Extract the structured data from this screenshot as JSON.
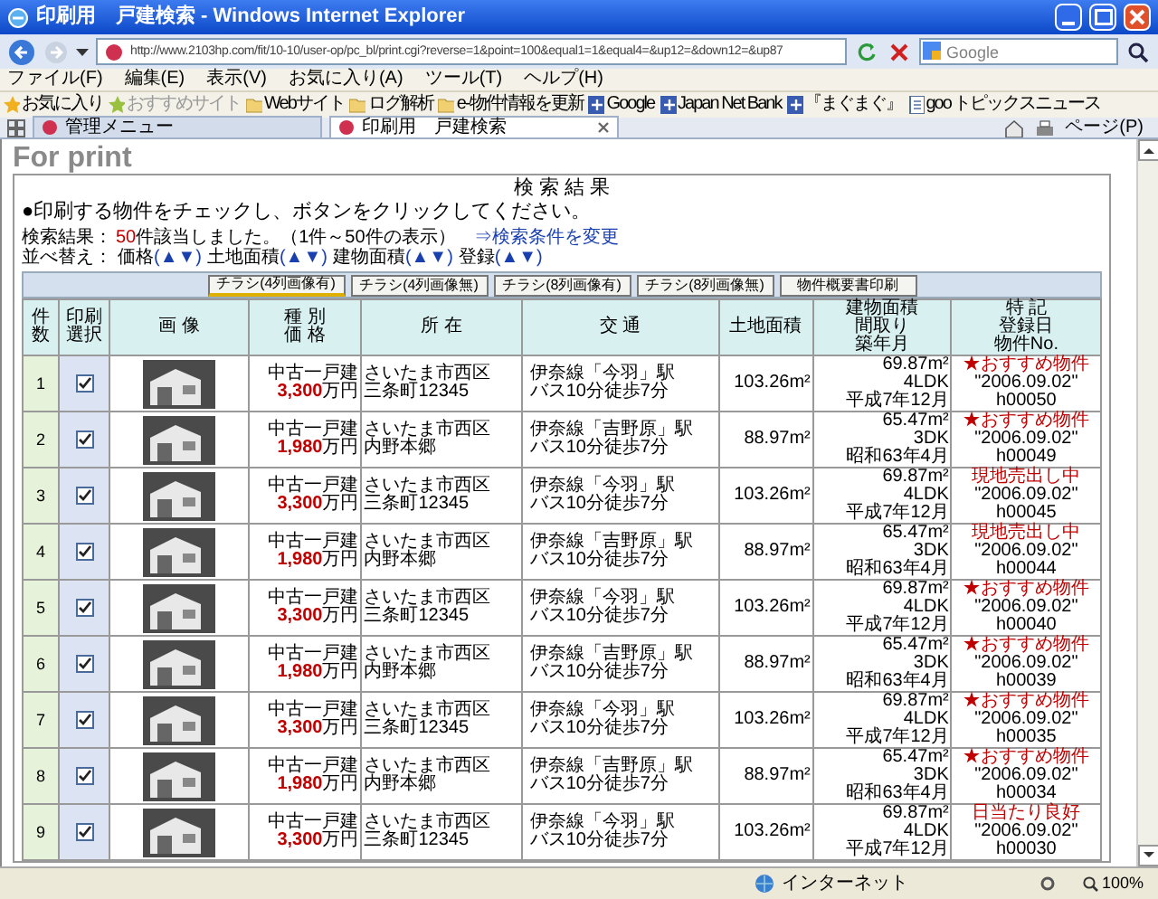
{
  "window": {
    "title": "印刷用　戸建検索 - Windows Internet Explorer"
  },
  "address_bar": {
    "url": "http://www.2103hp.com/fit/10-10/user-op/pc_bl/print.cgi?reverse=1&point=100&equal1=1&equal4=&up12=&down12=&up87"
  },
  "search_box": {
    "placeholder": "Google"
  },
  "menu": [
    "ファイル(F)",
    "編集(E)",
    "表示(V)",
    "お気に入り(A)",
    "ツール(T)",
    "ヘルプ(H)"
  ],
  "favorites_bar": {
    "label": "お気に入り",
    "items": [
      {
        "label": "おすすめサイト",
        "kind": "feed",
        "disabled": true
      },
      {
        "label": "Webサイト",
        "kind": "folder",
        "disabled": false
      },
      {
        "label": "ログ解析",
        "kind": "folder",
        "disabled": false
      },
      {
        "label": "e-物件情報を更新",
        "kind": "folder",
        "disabled": false
      },
      {
        "label": "Google",
        "kind": "site",
        "disabled": false
      },
      {
        "label": "Japan Net Bank",
        "kind": "site",
        "disabled": false
      },
      {
        "label": "『まぐまぐ』",
        "kind": "site",
        "disabled": false
      },
      {
        "label": "goo トピックスニュース",
        "kind": "page",
        "disabled": false
      }
    ],
    "page_menu": "ページ(P)"
  },
  "tabs": [
    {
      "label": "管理メニュー",
      "selected": false
    },
    {
      "label": "印刷用　戸建検索",
      "selected": true
    }
  ],
  "page": {
    "heading": "For print",
    "panel_title": "検 索 結 果",
    "instruction": "●印刷する物件をチェックし、ボタンをクリックしてください。",
    "result": {
      "label": "検索結果：",
      "count": "50",
      "text": "件該当しました。（1件～50件の表示）",
      "link": "⇒検索条件を変更"
    },
    "sort": {
      "label": "並べ替え：",
      "items": [
        {
          "label": "価格",
          "arrows": "(▲▼)"
        },
        {
          "label": "土地面積",
          "arrows": "(▲▼)"
        },
        {
          "label": "建物面積",
          "arrows": "(▲▼)"
        },
        {
          "label": "登録",
          "arrows": "(▲▼)"
        }
      ]
    },
    "buttons": [
      {
        "label": "チラシ(4列画像有)",
        "selected": true
      },
      {
        "label": "チラシ(4列画像無)",
        "selected": false
      },
      {
        "label": "チラシ(8列画像有)",
        "selected": false
      },
      {
        "label": "チラシ(8列画像無)",
        "selected": false
      },
      {
        "label": "物件概要書印刷",
        "selected": false
      }
    ],
    "table": {
      "columns": [
        [
          "件",
          "数"
        ],
        [
          "印刷",
          "選択"
        ],
        [
          "画 像"
        ],
        [
          "種 別",
          "価 格"
        ],
        [
          "所 在"
        ],
        [
          "交 通"
        ],
        [
          "土地面積"
        ],
        [
          "建物面積",
          "間取り",
          "築年月"
        ],
        [
          "特 記",
          "登録日",
          "物件No."
        ]
      ],
      "rows": [
        {
          "no": "1",
          "checked": true,
          "type": "中古一戸建",
          "price": "3,300",
          "unit": "万円",
          "address": [
            "さいたま市西区",
            "三条町12345"
          ],
          "access": [
            "伊奈線「今羽」駅",
            "バス10分徒歩7分"
          ],
          "land_area": "103.26m²",
          "building": [
            "69.87m²",
            "4LDK",
            "平成7年12月"
          ],
          "remark": "★おすすめ物件",
          "date": "\"2006.09.02\"",
          "id": "h00050"
        },
        {
          "no": "2",
          "checked": true,
          "type": "中古一戸建",
          "price": "1,980",
          "unit": "万円",
          "address": [
            "さいたま市西区",
            "内野本郷"
          ],
          "access": [
            "伊奈線「吉野原」駅",
            "バス10分徒歩7分"
          ],
          "land_area": "88.97m²",
          "building": [
            "65.47m²",
            "3DK",
            "昭和63年4月"
          ],
          "remark": "★おすすめ物件",
          "date": "\"2006.09.02\"",
          "id": "h00049"
        },
        {
          "no": "3",
          "checked": true,
          "type": "中古一戸建",
          "price": "3,300",
          "unit": "万円",
          "address": [
            "さいたま市西区",
            "三条町12345"
          ],
          "access": [
            "伊奈線「今羽」駅",
            "バス10分徒歩7分"
          ],
          "land_area": "103.26m²",
          "building": [
            "69.87m²",
            "4LDK",
            "平成7年12月"
          ],
          "remark": "現地売出し中",
          "date": "\"2006.09.02\"",
          "id": "h00045"
        },
        {
          "no": "4",
          "checked": true,
          "type": "中古一戸建",
          "price": "1,980",
          "unit": "万円",
          "address": [
            "さいたま市西区",
            "内野本郷"
          ],
          "access": [
            "伊奈線「吉野原」駅",
            "バス10分徒歩7分"
          ],
          "land_area": "88.97m²",
          "building": [
            "65.47m²",
            "3DK",
            "昭和63年4月"
          ],
          "remark": "現地売出し中",
          "date": "\"2006.09.02\"",
          "id": "h00044"
        },
        {
          "no": "5",
          "checked": true,
          "type": "中古一戸建",
          "price": "3,300",
          "unit": "万円",
          "address": [
            "さいたま市西区",
            "三条町12345"
          ],
          "access": [
            "伊奈線「今羽」駅",
            "バス10分徒歩7分"
          ],
          "land_area": "103.26m²",
          "building": [
            "69.87m²",
            "4LDK",
            "平成7年12月"
          ],
          "remark": "★おすすめ物件",
          "date": "\"2006.09.02\"",
          "id": "h00040"
        },
        {
          "no": "6",
          "checked": true,
          "type": "中古一戸建",
          "price": "1,980",
          "unit": "万円",
          "address": [
            "さいたま市西区",
            "内野本郷"
          ],
          "access": [
            "伊奈線「吉野原」駅",
            "バス10分徒歩7分"
          ],
          "land_area": "88.97m²",
          "building": [
            "65.47m²",
            "3DK",
            "昭和63年4月"
          ],
          "remark": "★おすすめ物件",
          "date": "\"2006.09.02\"",
          "id": "h00039"
        },
        {
          "no": "7",
          "checked": true,
          "type": "中古一戸建",
          "price": "3,300",
          "unit": "万円",
          "address": [
            "さいたま市西区",
            "三条町12345"
          ],
          "access": [
            "伊奈線「今羽」駅",
            "バス10分徒歩7分"
          ],
          "land_area": "103.26m²",
          "building": [
            "69.87m²",
            "4LDK",
            "平成7年12月"
          ],
          "remark": "★おすすめ物件",
          "date": "\"2006.09.02\"",
          "id": "h00035"
        },
        {
          "no": "8",
          "checked": true,
          "type": "中古一戸建",
          "price": "1,980",
          "unit": "万円",
          "address": [
            "さいたま市西区",
            "内野本郷"
          ],
          "access": [
            "伊奈線「吉野原」駅",
            "バス10分徒歩7分"
          ],
          "land_area": "88.97m²",
          "building": [
            "65.47m²",
            "3DK",
            "昭和63年4月"
          ],
          "remark": "★おすすめ物件",
          "date": "\"2006.09.02\"",
          "id": "h00034"
        },
        {
          "no": "9",
          "checked": true,
          "type": "中古一戸建",
          "price": "3,300",
          "unit": "万円",
          "address": [
            "さいたま市西区",
            "三条町12345"
          ],
          "access": [
            "伊奈線「今羽」駅",
            "バス10分徒歩7分"
          ],
          "land_area": "103.26m²",
          "building": [
            "69.87m²",
            "4LDK",
            "平成7年12月"
          ],
          "remark": "日当たり良好",
          "date": "\"2006.09.02\"",
          "id": "h00030"
        }
      ]
    }
  },
  "status_bar": {
    "zone": "インターネット",
    "zoom": "100%"
  }
}
